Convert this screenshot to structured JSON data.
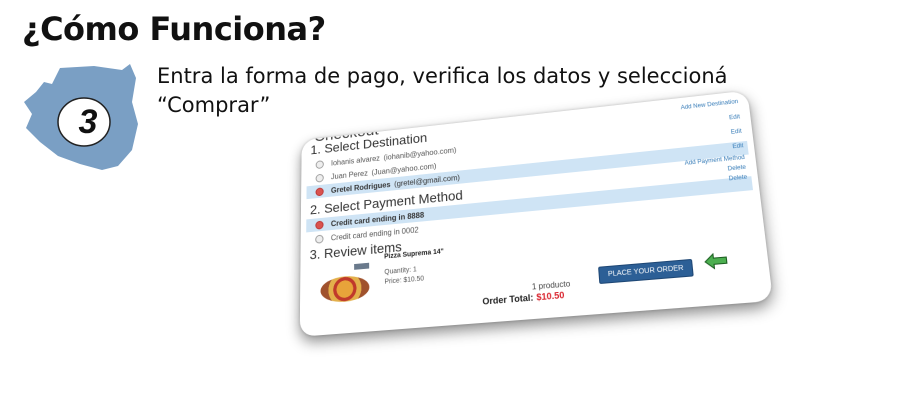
{
  "slide": {
    "title": "¿Cómo Funciona?",
    "step_number": "3",
    "instruction_line1": "Entra la forma de pago, verifica los datos y seleccioná",
    "instruction_line2": "“Comprar”",
    "badge_color": "#7a9fc4"
  },
  "checkout": {
    "title": "Checkout",
    "section1_heading": "1. Select Destination",
    "add_address_link": "Add New Destination",
    "addresses": [
      {
        "name": "Iohanis alvarez",
        "email": "(iohanib@yahoo.com)",
        "selected": false,
        "link": "Edit"
      },
      {
        "name": "Juan Perez",
        "email": "(Juan@yahoo.com)",
        "selected": false,
        "link": "Edit"
      },
      {
        "name": "Gretel Rodrigues",
        "email": "(gretel@gmail.com)",
        "selected": true,
        "link": "Edit"
      }
    ],
    "section2_heading": "2. Select Payment Method",
    "add_payment_link": "Add Payment Method",
    "payments": [
      {
        "label": "Credit card ending in 8888",
        "selected": true,
        "link": "Delete"
      },
      {
        "label": "Credit card ending in 0002",
        "selected": false,
        "link": "Delete"
      }
    ],
    "section3_heading": "3. Review items",
    "item_name": "Pizza Suprema 14\"",
    "item_quantity": "Quantity: 1",
    "item_price": "Price: $10.50",
    "product_count": "1 producto",
    "order_total_label": "Order Total:",
    "order_total_value": "$10.50",
    "place_order_label": "PLACE YOUR ORDER",
    "selected_row_color": "#cfe4f5",
    "button_color": "#2c5f96",
    "arrow_color": "#4caf50"
  }
}
